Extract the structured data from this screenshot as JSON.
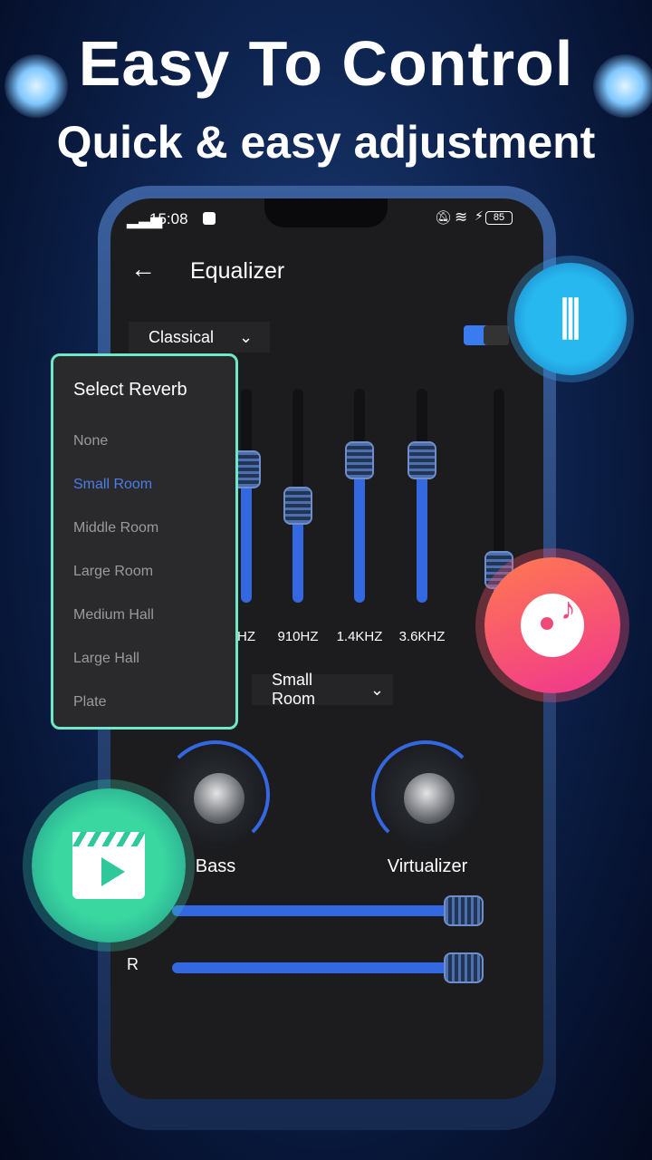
{
  "headline": "Easy To Control",
  "subheadline": "Quick & easy adjustment",
  "status_bar": {
    "time": "15:08",
    "battery": "85"
  },
  "header": {
    "title": "Equalizer"
  },
  "preset": {
    "selected": "Classical"
  },
  "eq_enabled": true,
  "bands": [
    {
      "label": "HZ",
      "level": 0.62
    },
    {
      "label": "910HZ",
      "level": 0.45
    },
    {
      "label": "1.4KHZ",
      "level": 0.66
    },
    {
      "label": "3.6KHZ",
      "level": 0.66
    },
    {
      "label": "",
      "level": 0.15
    }
  ],
  "reverb": {
    "selected": "Small Room"
  },
  "reverb_popup": {
    "title": "Select Reverb",
    "items": [
      "None",
      "Small Room",
      "Middle Room",
      "Large Room",
      "Medium Hall",
      "Large Hall",
      "Plate"
    ],
    "selected_index": 1
  },
  "knobs": [
    {
      "label": "Bass",
      "value": 0.55
    },
    {
      "label": "Virtualizer",
      "value": 0.35
    }
  ],
  "balance": [
    {
      "label": "",
      "value": 1.0
    },
    {
      "label": "R",
      "value": 1.0
    }
  ],
  "colors": {
    "accent": "#3468e0",
    "popup_border": "#6fe8c7",
    "selected": "#4a7ee8"
  }
}
